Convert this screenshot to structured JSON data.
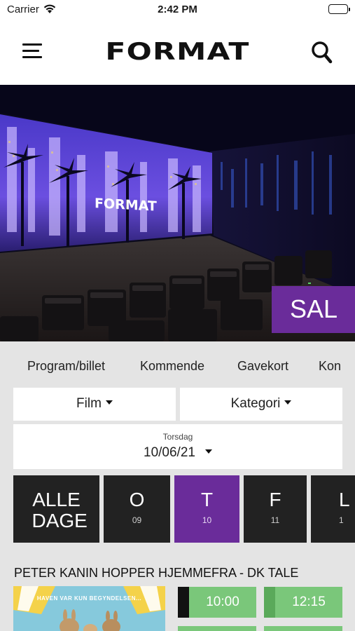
{
  "status_bar": {
    "carrier": "Carrier",
    "time": "2:42 PM"
  },
  "header": {
    "logo": "FORMAT",
    "menu_icon": "hamburger-menu-icon",
    "search_icon": "search-icon"
  },
  "hero": {
    "screen_logo": "FORMAT",
    "badge": "SAL",
    "badge_color": "#6a2c9a"
  },
  "tabs": [
    "Program/billet",
    "Kommende",
    "Gavekort",
    "Kon"
  ],
  "filters": {
    "film": "Film",
    "category": "Kategori"
  },
  "date_picker": {
    "weekday": "Torsdag",
    "date": "10/06/21"
  },
  "days": [
    {
      "label": "ALLE DAGE",
      "number": ""
    },
    {
      "label": "O",
      "number": "09"
    },
    {
      "label": "T",
      "number": "10",
      "active": true
    },
    {
      "label": "F",
      "number": "11"
    },
    {
      "label": "L",
      "number": "1"
    }
  ],
  "movie": {
    "title": "PETER KANIN HOPPER HJEMMEFRA - DK TALE",
    "poster_caption": "HAVEN VAR KUN BEGYNDELSEN...",
    "showtimes": [
      "10:00",
      "12:15"
    ]
  },
  "colors": {
    "accent": "#6a2c9a",
    "showtime": "#7ac77a",
    "day_tile": "#222222",
    "section_bg": "#e4e4e4"
  }
}
